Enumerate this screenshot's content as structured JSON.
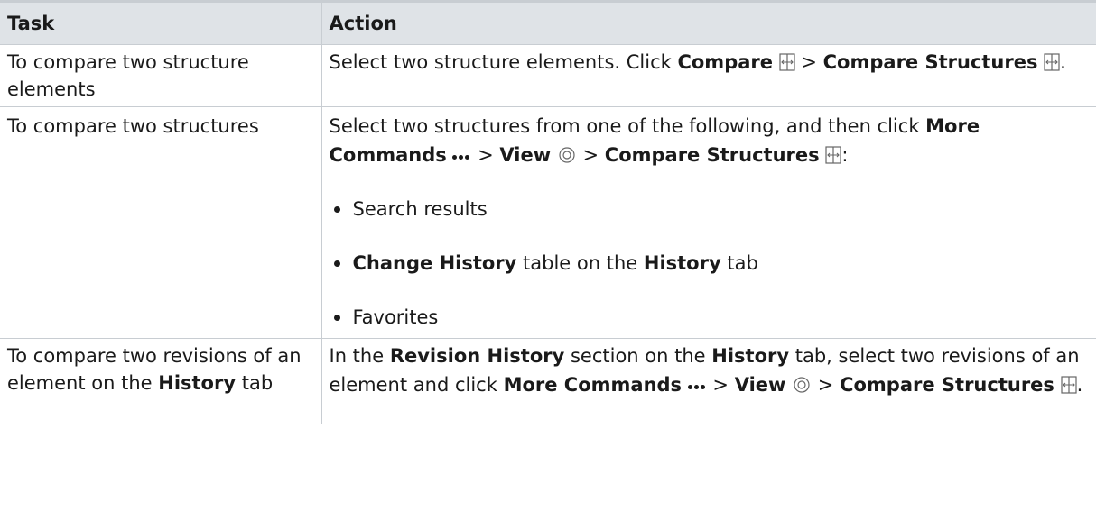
{
  "table": {
    "headers": {
      "task": "Task",
      "action": "Action"
    },
    "rows": [
      {
        "task": "To compare two structure elements",
        "action": {
          "t1": "Select two structure elements. Click ",
          "b1": "Compare",
          "t2": " > ",
          "b2": "Compare Structures",
          "t3": "."
        }
      },
      {
        "task": "To compare two structures",
        "action": {
          "t1": "Select two structures from one of the following, and then click ",
          "b1": "More Commands",
          "t2": " > ",
          "b2": "View",
          "t3": " > ",
          "b3": "Compare Structures",
          "t4": ":",
          "bullets": [
            {
              "text": "Search results"
            },
            {
              "b1": "Change History",
              "t1": " table on the ",
              "b2": "History",
              "t2": " tab"
            },
            {
              "text": "Favorites"
            }
          ]
        }
      },
      {
        "task_t1": "To compare two revisions of an element on the ",
        "task_b1": "History",
        "task_t2": " tab",
        "action": {
          "t1": "In the ",
          "b1": "Revision History",
          "t2": " section on the ",
          "b2": "History",
          "t3": " tab, select two revisions of an element and click ",
          "b3": "More Commands",
          "t4": " > ",
          "b4": "View",
          "t5": " > ",
          "b5": "Compare Structures",
          "t6": "."
        }
      }
    ]
  },
  "icons": {
    "compare": "compare-icon",
    "more_commands": "more-commands-icon",
    "view": "view-icon",
    "compare_structures": "compare-structures-icon"
  }
}
